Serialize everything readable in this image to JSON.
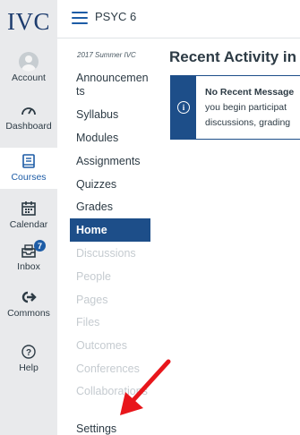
{
  "logo": {
    "text": "IVC"
  },
  "global_nav": [
    {
      "id": "account",
      "label": "Account",
      "icon": "user-avatar-icon"
    },
    {
      "id": "dashboard",
      "label": "Dashboard",
      "icon": "dashboard-gauge-icon"
    },
    {
      "id": "courses",
      "label": "Courses",
      "icon": "courses-book-icon",
      "active": true
    },
    {
      "id": "calendar",
      "label": "Calendar",
      "icon": "calendar-icon"
    },
    {
      "id": "inbox",
      "label": "Inbox",
      "icon": "inbox-icon",
      "badge": "7"
    },
    {
      "id": "commons",
      "label": "Commons",
      "icon": "commons-arrow-icon"
    },
    {
      "id": "help",
      "label": "Help",
      "icon": "help-question-icon"
    }
  ],
  "header": {
    "breadcrumb": "PSYC 6"
  },
  "course_nav": {
    "term": "2017 Summer IVC",
    "items": [
      {
        "label": "Announcements",
        "state": "normal"
      },
      {
        "label": "Syllabus",
        "state": "normal"
      },
      {
        "label": "Modules",
        "state": "normal"
      },
      {
        "label": "Assignments",
        "state": "normal"
      },
      {
        "label": "Quizzes",
        "state": "normal"
      },
      {
        "label": "Grades",
        "state": "normal"
      },
      {
        "label": "Home",
        "state": "active"
      },
      {
        "label": "Discussions",
        "state": "disabled"
      },
      {
        "label": "People",
        "state": "disabled"
      },
      {
        "label": "Pages",
        "state": "disabled"
      },
      {
        "label": "Files",
        "state": "disabled"
      },
      {
        "label": "Outcomes",
        "state": "disabled"
      },
      {
        "label": "Conferences",
        "state": "disabled"
      },
      {
        "label": "Collaborations",
        "state": "disabled"
      },
      {
        "label": "Settings",
        "state": "normal"
      }
    ]
  },
  "main": {
    "title": "Recent Activity in",
    "alert": {
      "heading": "No Recent Message",
      "line1": "you begin participat",
      "line2": "discussions, grading"
    }
  },
  "colors": {
    "brand_navy": "#1d4e89",
    "link_blue": "#1d5ca6",
    "nav_bg": "#e9eaec",
    "disabled_text": "#c5cbd0",
    "annotation_red": "#e8161b"
  }
}
